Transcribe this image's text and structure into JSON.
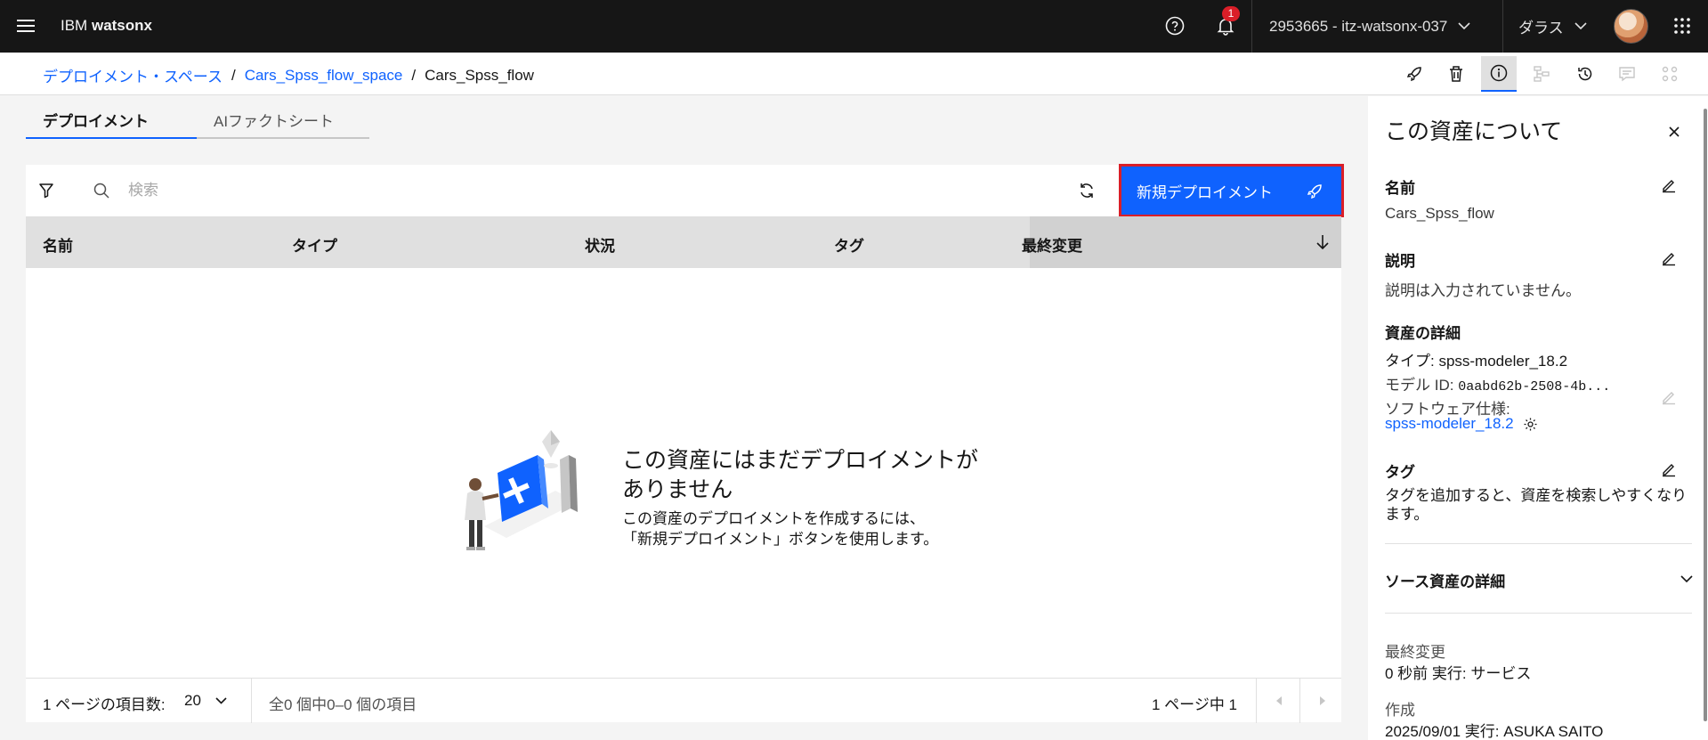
{
  "header": {
    "brand_prefix": "IBM",
    "brand_name": "watsonx",
    "notification_count": "1",
    "account": "2953665 - itz-watsonx-037",
    "region": "ダラス"
  },
  "breadcrumb": {
    "items": [
      "デプロイメント・スペース",
      "Cars_Spss_flow_space",
      "Cars_Spss_flow"
    ],
    "separator": "/"
  },
  "tabs": [
    {
      "label": "デプロイメント"
    },
    {
      "label": "AIファクトシート"
    }
  ],
  "toolbar": {
    "search_placeholder": "検索",
    "new_deployment_label": "新規デプロイメント"
  },
  "table": {
    "columns": [
      "名前",
      "タイプ",
      "状況",
      "タグ",
      "最終変更"
    ],
    "rows": []
  },
  "empty_state": {
    "title": "この資産にはまだデプロイメントがありません",
    "line1": "この資産のデプロイメントを作成するには、",
    "line2": "「新規デプロイメント」ボタンを使用します。"
  },
  "pagination": {
    "items_per_page_label": "1 ページの項目数:",
    "items_per_page": "20",
    "range_text": "全0 個中0–0 個の項目",
    "page_text": "1 ページ中 1"
  },
  "side_panel": {
    "title": "この資産について",
    "name_label": "名前",
    "name_value": "Cars_Spss_flow",
    "description_label": "説明",
    "description_value": "説明は入力されていません。",
    "details_label": "資産の詳細",
    "type_text": "タイプ: spss-modeler_18.2",
    "model_id_label": "モデル ID:",
    "model_id_value": "0aabd62b-2508-4b...",
    "software_spec_label": "ソフトウェア仕様:",
    "software_spec_link": "spss-modeler_18.2",
    "tags_label": "タグ",
    "tags_line1": "タグを追加すると、資産を検索しやすくなり",
    "tags_line2": "ます。",
    "source_details_label": "ソース資産の詳細",
    "last_modified_label": "最終変更",
    "last_modified_value": "0 秒前 実行: サービス",
    "created_label": "作成",
    "created_value": "2025/09/01 実行: ASUKA SAITO"
  },
  "colors": {
    "primary": "#0f62fe",
    "header_bg": "#161616",
    "highlight_border": "#da1e28"
  }
}
